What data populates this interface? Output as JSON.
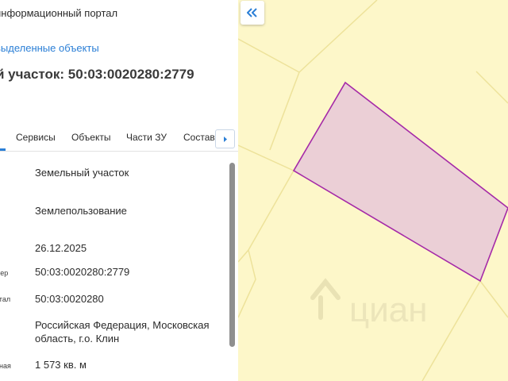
{
  "panel": {
    "portal_title": "информационный портал",
    "selected_link": "выделенные объекты",
    "object_title": "й участок: 50:03:0020280:2779"
  },
  "tabs": [
    {
      "label": "Сервисы"
    },
    {
      "label": "Объекты"
    },
    {
      "label": "Части ЗУ"
    },
    {
      "label": "Состав"
    }
  ],
  "properties": [
    {
      "label": "",
      "value": "Земельный участок"
    },
    {
      "label": "",
      "value": "Землепользование"
    },
    {
      "label": "",
      "value": "26.12.2025"
    },
    {
      "label": "мер",
      "value": "50:03:0020280:2779"
    },
    {
      "label": "ртал",
      "value": "50:03:0020280"
    },
    {
      "label": "",
      "value_line1": "Российская Федерация, Московская",
      "value_line2": "область, г.о. Клин"
    },
    {
      "label": "нная",
      "value": "1 573 кв. м"
    }
  ],
  "map": {
    "background_color": "#fdf7c9",
    "parcel_line_color": "#ede29a",
    "selected_parcel_fill": "#ebcfd6",
    "selected_parcel_stroke": "#a52aa8",
    "watermark_text": "циан"
  },
  "icons": {
    "collapse": "double-chevron-left-icon",
    "tab_scroll": "caret-right-icon"
  },
  "colors": {
    "accent": "#2b7fd6"
  }
}
